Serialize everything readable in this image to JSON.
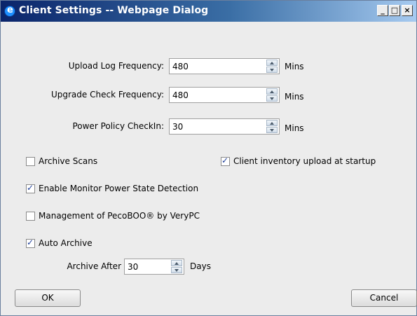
{
  "window": {
    "title": "Client Settings -- Webpage Dialog",
    "controls": {
      "minimize": "_",
      "maximize": "□",
      "close": "×"
    }
  },
  "fields": [
    {
      "label": "Upload Log Frequency:",
      "value": "480",
      "unit": "Mins"
    },
    {
      "label": "Upgrade Check Frequency:",
      "value": "480",
      "unit": "Mins"
    },
    {
      "label": "Power Policy CheckIn:",
      "value": "30",
      "unit": "Mins"
    }
  ],
  "checkboxes": {
    "archive_scans": {
      "label": "Archive Scans",
      "checked": false
    },
    "client_inventory": {
      "label": "Client inventory upload at startup",
      "checked": true
    },
    "monitor_power": {
      "label": "Enable Monitor Power State Detection",
      "checked": true
    },
    "pecoboo": {
      "label": "Management of PecoBOO® by VeryPC",
      "checked": false
    },
    "auto_archive": {
      "label": "Auto Archive",
      "checked": true
    }
  },
  "archive_after": {
    "label": "Archive After",
    "value": "30",
    "unit": "Days"
  },
  "buttons": {
    "ok": "OK",
    "cancel": "Cancel"
  },
  "icons": {
    "app": "ie-icon"
  }
}
